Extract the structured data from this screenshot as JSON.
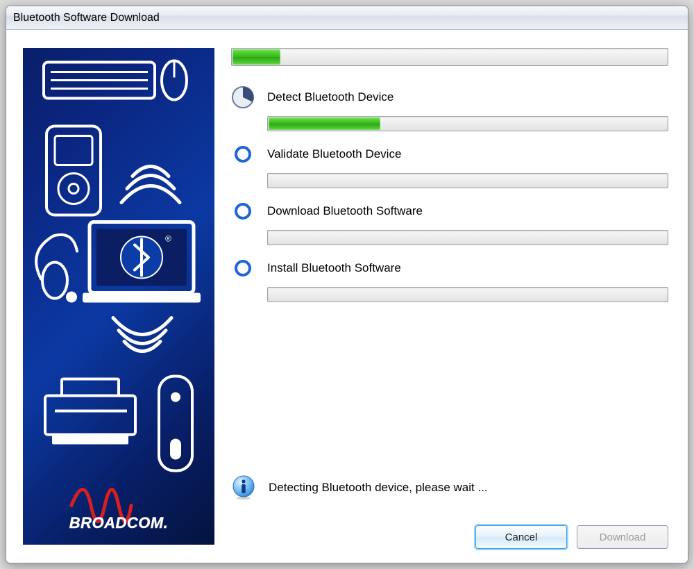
{
  "window": {
    "title": "Bluetooth Software Download"
  },
  "progress": {
    "overall_percent": 11
  },
  "steps": [
    {
      "label": "Detect Bluetooth Device",
      "state": "active",
      "progress_percent": 28
    },
    {
      "label": "Validate Bluetooth Device",
      "state": "pending",
      "progress_percent": 0
    },
    {
      "label": "Download Bluetooth Software",
      "state": "pending",
      "progress_percent": 0
    },
    {
      "label": "Install Bluetooth Software",
      "state": "pending",
      "progress_percent": 0
    }
  ],
  "info": {
    "message": "Detecting Bluetooth device, please wait ..."
  },
  "buttons": {
    "cancel": "Cancel",
    "download": "Download",
    "download_enabled": false
  },
  "brand": {
    "name": "BROADCOM."
  }
}
